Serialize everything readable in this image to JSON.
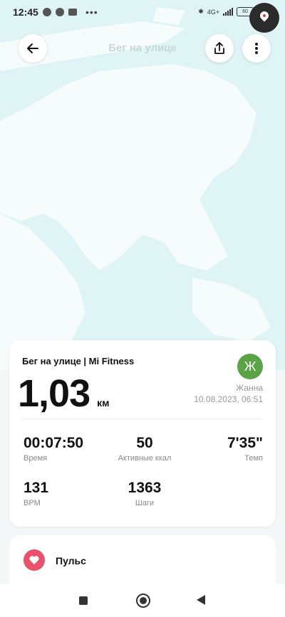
{
  "status_bar": {
    "time": "12:45",
    "network": "4G+",
    "battery": "60"
  },
  "header": {
    "title": "Бег на улице",
    "back_icon": "arrow-left-icon",
    "share_icon": "share-icon",
    "more_icon": "more-vertical-icon"
  },
  "workout": {
    "title": "Бег на улице | Mi Fitness",
    "distance": "1,03",
    "distance_unit": "км",
    "user_initial": "Ж",
    "user_name": "Жанна",
    "datetime": "10.08.2023, 06:51",
    "avatar_color": "#5aa447"
  },
  "stats": [
    {
      "value": "00:07:50",
      "label": "Время"
    },
    {
      "value": "50",
      "label": "Активные ккал"
    },
    {
      "value": "7'35\"",
      "label": "Темп"
    },
    {
      "value": "131",
      "label": "BPM"
    },
    {
      "value": "1363",
      "label": "Шаги"
    }
  ],
  "pulse": {
    "label": "Пульс",
    "icon": "heart-icon",
    "color": "#e8526a"
  }
}
